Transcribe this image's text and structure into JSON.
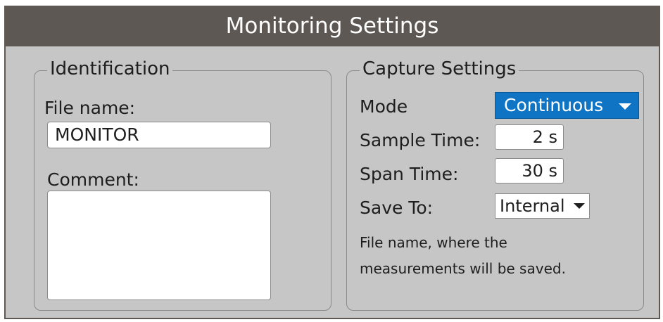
{
  "window": {
    "title": "Monitoring Settings"
  },
  "identification": {
    "legend": "Identification",
    "file_name_label": "File name:",
    "file_name_value": "MONITOR",
    "comment_label": "Comment:",
    "comment_value": ""
  },
  "capture": {
    "legend": "Capture Settings",
    "mode_label": "Mode",
    "mode_value": "Continuous",
    "sample_time_label": "Sample Time:",
    "sample_time_value": "2 s",
    "span_time_label": "Span Time:",
    "span_time_value": "30 s",
    "save_to_label": "Save To:",
    "save_to_value": "Internal",
    "hint_line1": "File name, where the",
    "hint_line2": "measurements will be saved."
  },
  "colors": {
    "titlebar": "#5e5854",
    "panel": "#c6c6c6",
    "accent": "#0f74c3"
  },
  "icons": {
    "mode_dropdown": "chevron-down-icon",
    "save_to_dropdown": "chevron-down-icon"
  }
}
